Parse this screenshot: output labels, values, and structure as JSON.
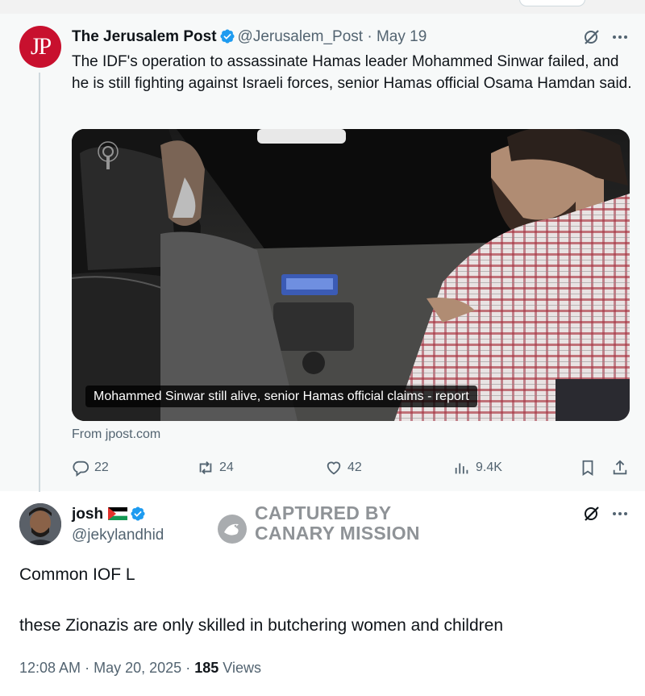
{
  "quoted_tweet": {
    "avatar_text": "JP",
    "author_name": "The Jerusalem Post",
    "handle": "@Jerusalem_Post",
    "separator": "·",
    "date": "May 19",
    "text": "The IDF's operation to assassinate Hamas leader Mohammed Sinwar failed, and he is still fighting against Israeli forces, senior Hamas official Osama Hamdan said.",
    "media_caption": "Mohammed Sinwar still alive, senior Hamas official claims - report",
    "source": "From jpost.com",
    "actions": {
      "replies": "22",
      "retweets": "24",
      "likes": "42",
      "views": "9.4K"
    }
  },
  "reply_tweet": {
    "author_name": "josh",
    "handle": "@jekylandhid",
    "body_line1": "Common IOF L",
    "body_line2": "these Zionazis are only skilled in butchering women and children",
    "time": "12:08 AM",
    "separator": "·",
    "date": "May 20, 2025",
    "separator2": "·",
    "views_count": "185",
    "views_label": "Views"
  },
  "watermark": {
    "line1": "CAPTURED BY",
    "line2": "CANARY MISSION"
  },
  "colors": {
    "text_primary": "#0f1419",
    "text_secondary": "#536471",
    "verified_blue": "#1d9bf0",
    "jp_red": "#c8102e",
    "quoted_bg": "#f7f9f9"
  },
  "icons": [
    "verified-badge-icon",
    "grok-icon",
    "more-icon",
    "reply-icon",
    "retweet-icon",
    "like-icon",
    "views-icon",
    "bookmark-icon",
    "share-icon",
    "palestine-flag-icon",
    "canary-logo-icon"
  ]
}
